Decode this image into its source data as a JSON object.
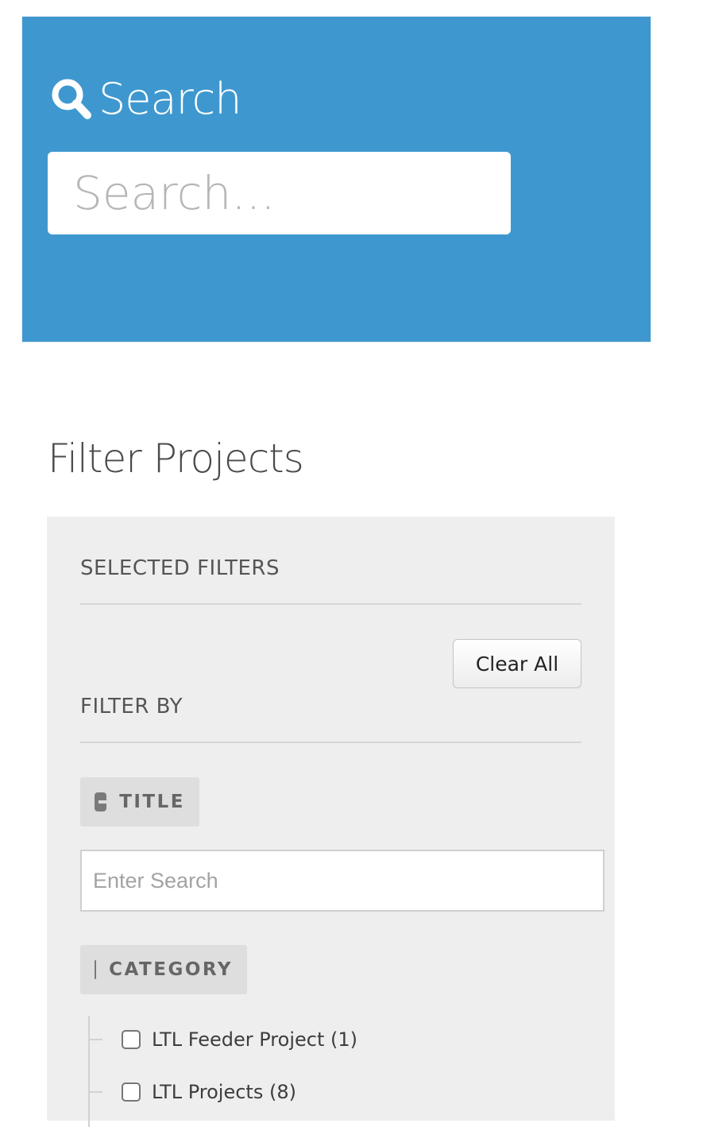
{
  "search": {
    "heading": "Search",
    "placeholder": "Search...",
    "icon": "search-icon",
    "panel_color": "#3e98cf"
  },
  "filters": {
    "heading": "Filter Projects",
    "selected_label": "SELECTED FILTERS",
    "clear_all_label": "Clear All",
    "filter_by_label": "FILTER BY",
    "facets": {
      "title": {
        "label": "TITLE",
        "input_placeholder": "Enter Search",
        "icon": "minus-icon"
      },
      "category": {
        "label": "CATEGORY",
        "icon": "minus-icon",
        "options": [
          {
            "label": "LTL Feeder Project (1)",
            "checked": false
          },
          {
            "label": "LTL Projects (8)",
            "checked": false
          }
        ]
      }
    }
  }
}
